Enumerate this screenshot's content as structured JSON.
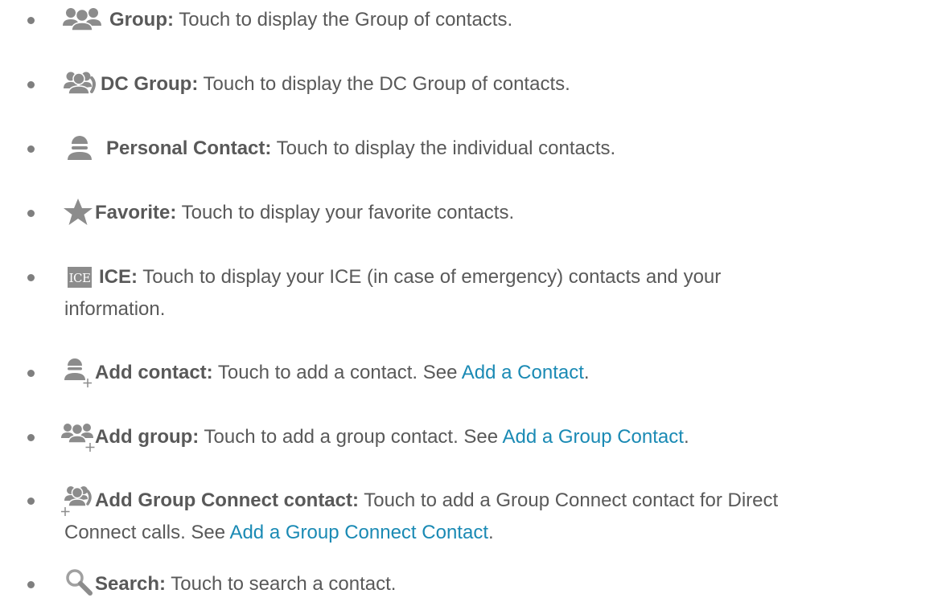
{
  "items": [
    {
      "icon": "group-icon",
      "term": "Group:",
      "desc": " Touch to display the Group of contacts."
    },
    {
      "icon": "dc-group-icon",
      "term": "DC Group:",
      "desc": " Touch to display the DC Group of contacts."
    },
    {
      "icon": "person-icon",
      "term": "Personal Contact:",
      "desc": " Touch to display the individual contacts."
    },
    {
      "icon": "star-icon",
      "term": "Favorite:",
      "desc": " Touch to display your favorite contacts."
    },
    {
      "icon": "ice-icon",
      "icon_text": "ICE",
      "term": "ICE:",
      "desc": " Touch to display your ICE (in case of emergency) contacts and your",
      "desc2": "information."
    },
    {
      "icon": "add-contact-icon",
      "term": "Add contact:",
      "desc": " Touch to add a contact. See ",
      "link": "Add a Contact",
      "after": "."
    },
    {
      "icon": "add-group-icon",
      "term": "Add group:",
      "desc": " Touch to add a group contact. See ",
      "link": "Add a Group Contact",
      "after": "."
    },
    {
      "icon": "add-group-connect-icon",
      "term": "Add Group Connect contact:",
      "desc": " Touch to add a Group Connect contact for Direct",
      "desc2": "Connect calls. See ",
      "link": "Add a Group Connect Contact",
      "after": "."
    },
    {
      "icon": "search-icon",
      "term": "Search:",
      "desc": " Touch to search a contact."
    }
  ],
  "colors": {
    "text": "#595959",
    "icon": "#8c8c8c",
    "link": "#1a8ab4",
    "bullet": "#7f7f7f"
  }
}
